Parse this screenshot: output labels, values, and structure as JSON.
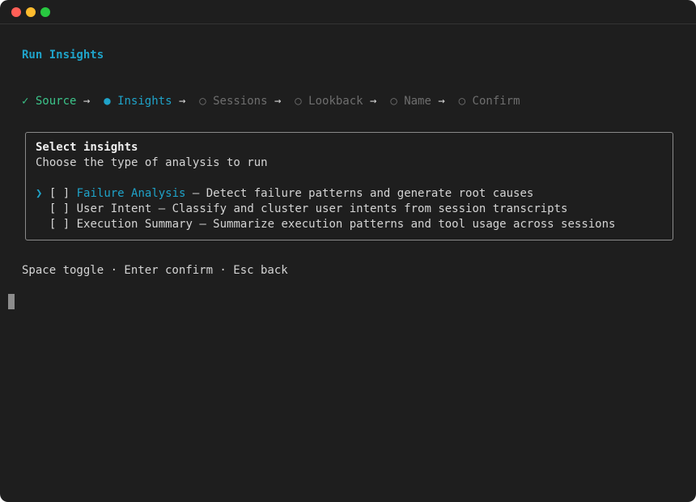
{
  "title": "Run Insights",
  "steps": [
    {
      "marker": "✓",
      "label": "Source",
      "state": "done"
    },
    {
      "marker": "●",
      "label": "Insights",
      "state": "active"
    },
    {
      "marker": "○",
      "label": "Sessions",
      "state": "pending"
    },
    {
      "marker": "○",
      "label": "Lookback",
      "state": "pending"
    },
    {
      "marker": "○",
      "label": "Name",
      "state": "pending"
    },
    {
      "marker": "○",
      "label": "Confirm",
      "state": "pending"
    }
  ],
  "arrow": "→",
  "panel": {
    "heading": "Select insights",
    "subheading": "Choose the type of analysis to run",
    "pointer": "❯",
    "options": [
      {
        "checkbox": "[ ]",
        "name": "Failure Analysis",
        "desc": " – Detect failure patterns and generate root causes"
      },
      {
        "checkbox": "[ ]",
        "name": "User Intent",
        "desc": " – Classify and cluster user intents from session transcripts"
      },
      {
        "checkbox": "[ ]",
        "name": "Execution Summary",
        "desc": " – Summarize execution patterns and tool usage across sessions"
      }
    ]
  },
  "help": "Space toggle · Enter confirm · Esc back",
  "colors": {
    "accent": "#1fa3c9",
    "done": "#3cc48a",
    "pending": "#6e6e6e",
    "background": "#1e1e1e"
  }
}
